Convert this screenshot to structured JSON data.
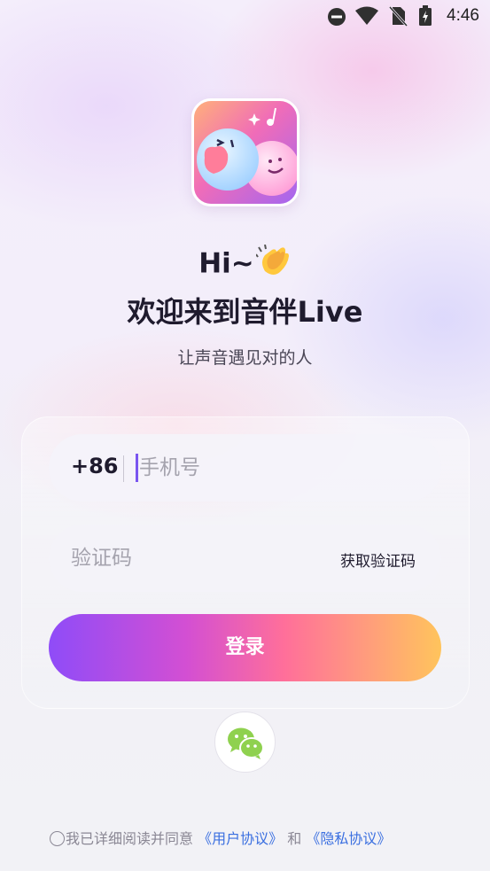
{
  "status_bar": {
    "time": "4:46",
    "icons": [
      "dnd-icon",
      "wifi-icon",
      "no-sim-icon",
      "battery-charging-icon"
    ]
  },
  "app": {
    "logo_icon": "app-logo-icon",
    "greeting": "Hi~",
    "greeting_emoji_icon": "clapping-hands-icon",
    "welcome": "欢迎来到音伴Live",
    "subtitle": "让声音遇见对的人"
  },
  "form": {
    "country_code": "+86",
    "phone_placeholder": "手机号",
    "phone_value": "",
    "code_placeholder": "验证码",
    "code_value": "",
    "get_code_label": "获取验证码",
    "login_label": "登录",
    "wechat_icon": "wechat-icon"
  },
  "agreement": {
    "prefix": "我已详细阅读并同意",
    "user_agreement": "《用户协议》",
    "and": "和",
    "privacy_policy": "《隐私协议》"
  },
  "colors": {
    "accent_purple": "#8f4cf8",
    "accent_pink": "#ff6f9a",
    "accent_orange": "#ffc45c",
    "link_blue": "#3a6fe0",
    "wechat_green": "#8fd14f"
  }
}
